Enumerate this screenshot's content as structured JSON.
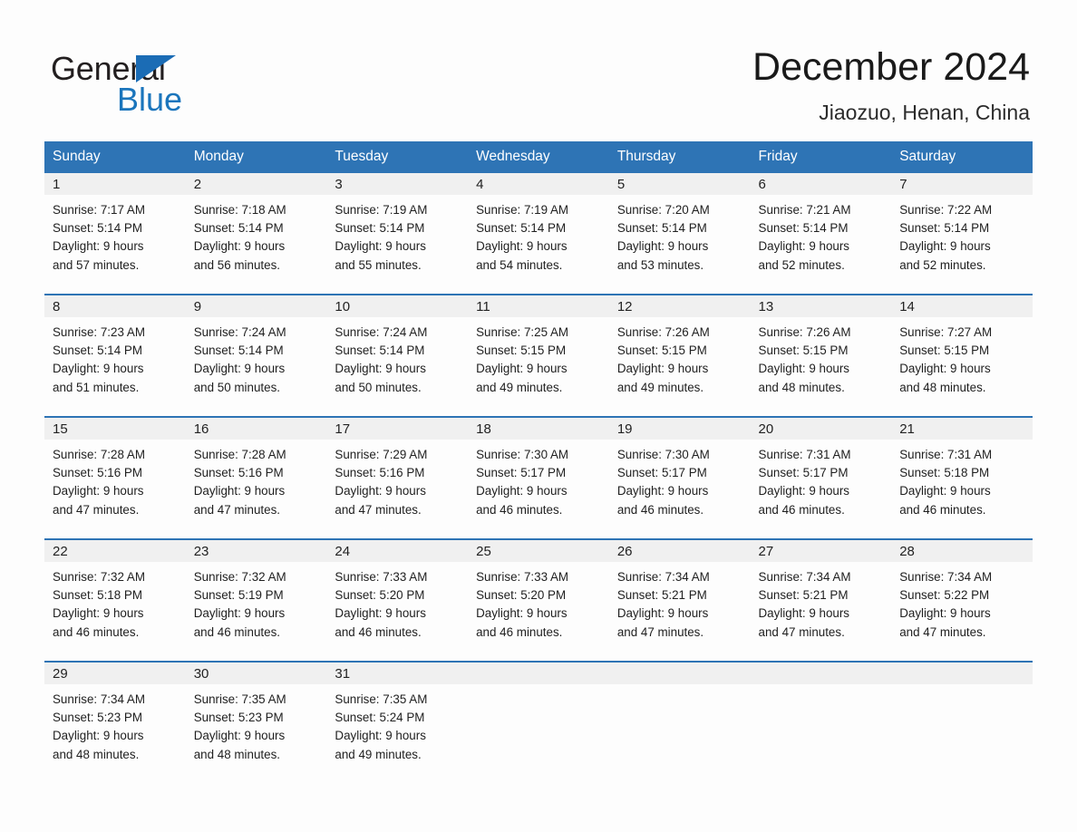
{
  "brand": {
    "name_part1": "General",
    "name_part2": "Blue",
    "accent_color": "#1b75bc",
    "triangle_color": "#1b6cb5"
  },
  "header": {
    "title": "December 2024",
    "subtitle": "Jiaozuo, Henan, China",
    "header_bar_color": "#2e74b5"
  },
  "weekday_headers": [
    "Sunday",
    "Monday",
    "Tuesday",
    "Wednesday",
    "Thursday",
    "Friday",
    "Saturday"
  ],
  "labels": {
    "sunrise_prefix": "Sunrise:",
    "sunset_prefix": "Sunset:",
    "daylight_prefix": "Daylight:"
  },
  "weeks": [
    [
      {
        "day": "1",
        "sunrise": "Sunrise: 7:17 AM",
        "sunset": "Sunset: 5:14 PM",
        "daylight_line1": "Daylight: 9 hours",
        "daylight_line2": "and 57 minutes."
      },
      {
        "day": "2",
        "sunrise": "Sunrise: 7:18 AM",
        "sunset": "Sunset: 5:14 PM",
        "daylight_line1": "Daylight: 9 hours",
        "daylight_line2": "and 56 minutes."
      },
      {
        "day": "3",
        "sunrise": "Sunrise: 7:19 AM",
        "sunset": "Sunset: 5:14 PM",
        "daylight_line1": "Daylight: 9 hours",
        "daylight_line2": "and 55 minutes."
      },
      {
        "day": "4",
        "sunrise": "Sunrise: 7:19 AM",
        "sunset": "Sunset: 5:14 PM",
        "daylight_line1": "Daylight: 9 hours",
        "daylight_line2": "and 54 minutes."
      },
      {
        "day": "5",
        "sunrise": "Sunrise: 7:20 AM",
        "sunset": "Sunset: 5:14 PM",
        "daylight_line1": "Daylight: 9 hours",
        "daylight_line2": "and 53 minutes."
      },
      {
        "day": "6",
        "sunrise": "Sunrise: 7:21 AM",
        "sunset": "Sunset: 5:14 PM",
        "daylight_line1": "Daylight: 9 hours",
        "daylight_line2": "and 52 minutes."
      },
      {
        "day": "7",
        "sunrise": "Sunrise: 7:22 AM",
        "sunset": "Sunset: 5:14 PM",
        "daylight_line1": "Daylight: 9 hours",
        "daylight_line2": "and 52 minutes."
      }
    ],
    [
      {
        "day": "8",
        "sunrise": "Sunrise: 7:23 AM",
        "sunset": "Sunset: 5:14 PM",
        "daylight_line1": "Daylight: 9 hours",
        "daylight_line2": "and 51 minutes."
      },
      {
        "day": "9",
        "sunrise": "Sunrise: 7:24 AM",
        "sunset": "Sunset: 5:14 PM",
        "daylight_line1": "Daylight: 9 hours",
        "daylight_line2": "and 50 minutes."
      },
      {
        "day": "10",
        "sunrise": "Sunrise: 7:24 AM",
        "sunset": "Sunset: 5:14 PM",
        "daylight_line1": "Daylight: 9 hours",
        "daylight_line2": "and 50 minutes."
      },
      {
        "day": "11",
        "sunrise": "Sunrise: 7:25 AM",
        "sunset": "Sunset: 5:15 PM",
        "daylight_line1": "Daylight: 9 hours",
        "daylight_line2": "and 49 minutes."
      },
      {
        "day": "12",
        "sunrise": "Sunrise: 7:26 AM",
        "sunset": "Sunset: 5:15 PM",
        "daylight_line1": "Daylight: 9 hours",
        "daylight_line2": "and 49 minutes."
      },
      {
        "day": "13",
        "sunrise": "Sunrise: 7:26 AM",
        "sunset": "Sunset: 5:15 PM",
        "daylight_line1": "Daylight: 9 hours",
        "daylight_line2": "and 48 minutes."
      },
      {
        "day": "14",
        "sunrise": "Sunrise: 7:27 AM",
        "sunset": "Sunset: 5:15 PM",
        "daylight_line1": "Daylight: 9 hours",
        "daylight_line2": "and 48 minutes."
      }
    ],
    [
      {
        "day": "15",
        "sunrise": "Sunrise: 7:28 AM",
        "sunset": "Sunset: 5:16 PM",
        "daylight_line1": "Daylight: 9 hours",
        "daylight_line2": "and 47 minutes."
      },
      {
        "day": "16",
        "sunrise": "Sunrise: 7:28 AM",
        "sunset": "Sunset: 5:16 PM",
        "daylight_line1": "Daylight: 9 hours",
        "daylight_line2": "and 47 minutes."
      },
      {
        "day": "17",
        "sunrise": "Sunrise: 7:29 AM",
        "sunset": "Sunset: 5:16 PM",
        "daylight_line1": "Daylight: 9 hours",
        "daylight_line2": "and 47 minutes."
      },
      {
        "day": "18",
        "sunrise": "Sunrise: 7:30 AM",
        "sunset": "Sunset: 5:17 PM",
        "daylight_line1": "Daylight: 9 hours",
        "daylight_line2": "and 46 minutes."
      },
      {
        "day": "19",
        "sunrise": "Sunrise: 7:30 AM",
        "sunset": "Sunset: 5:17 PM",
        "daylight_line1": "Daylight: 9 hours",
        "daylight_line2": "and 46 minutes."
      },
      {
        "day": "20",
        "sunrise": "Sunrise: 7:31 AM",
        "sunset": "Sunset: 5:17 PM",
        "daylight_line1": "Daylight: 9 hours",
        "daylight_line2": "and 46 minutes."
      },
      {
        "day": "21",
        "sunrise": "Sunrise: 7:31 AM",
        "sunset": "Sunset: 5:18 PM",
        "daylight_line1": "Daylight: 9 hours",
        "daylight_line2": "and 46 minutes."
      }
    ],
    [
      {
        "day": "22",
        "sunrise": "Sunrise: 7:32 AM",
        "sunset": "Sunset: 5:18 PM",
        "daylight_line1": "Daylight: 9 hours",
        "daylight_line2": "and 46 minutes."
      },
      {
        "day": "23",
        "sunrise": "Sunrise: 7:32 AM",
        "sunset": "Sunset: 5:19 PM",
        "daylight_line1": "Daylight: 9 hours",
        "daylight_line2": "and 46 minutes."
      },
      {
        "day": "24",
        "sunrise": "Sunrise: 7:33 AM",
        "sunset": "Sunset: 5:20 PM",
        "daylight_line1": "Daylight: 9 hours",
        "daylight_line2": "and 46 minutes."
      },
      {
        "day": "25",
        "sunrise": "Sunrise: 7:33 AM",
        "sunset": "Sunset: 5:20 PM",
        "daylight_line1": "Daylight: 9 hours",
        "daylight_line2": "and 46 minutes."
      },
      {
        "day": "26",
        "sunrise": "Sunrise: 7:34 AM",
        "sunset": "Sunset: 5:21 PM",
        "daylight_line1": "Daylight: 9 hours",
        "daylight_line2": "and 47 minutes."
      },
      {
        "day": "27",
        "sunrise": "Sunrise: 7:34 AM",
        "sunset": "Sunset: 5:21 PM",
        "daylight_line1": "Daylight: 9 hours",
        "daylight_line2": "and 47 minutes."
      },
      {
        "day": "28",
        "sunrise": "Sunrise: 7:34 AM",
        "sunset": "Sunset: 5:22 PM",
        "daylight_line1": "Daylight: 9 hours",
        "daylight_line2": "and 47 minutes."
      }
    ],
    [
      {
        "day": "29",
        "sunrise": "Sunrise: 7:34 AM",
        "sunset": "Sunset: 5:23 PM",
        "daylight_line1": "Daylight: 9 hours",
        "daylight_line2": "and 48 minutes."
      },
      {
        "day": "30",
        "sunrise": "Sunrise: 7:35 AM",
        "sunset": "Sunset: 5:23 PM",
        "daylight_line1": "Daylight: 9 hours",
        "daylight_line2": "and 48 minutes."
      },
      {
        "day": "31",
        "sunrise": "Sunrise: 7:35 AM",
        "sunset": "Sunset: 5:24 PM",
        "daylight_line1": "Daylight: 9 hours",
        "daylight_line2": "and 49 minutes."
      },
      {
        "day": "",
        "sunrise": "",
        "sunset": "",
        "daylight_line1": "",
        "daylight_line2": ""
      },
      {
        "day": "",
        "sunrise": "",
        "sunset": "",
        "daylight_line1": "",
        "daylight_line2": ""
      },
      {
        "day": "",
        "sunrise": "",
        "sunset": "",
        "daylight_line1": "",
        "daylight_line2": ""
      },
      {
        "day": "",
        "sunrise": "",
        "sunset": "",
        "daylight_line1": "",
        "daylight_line2": ""
      }
    ]
  ]
}
